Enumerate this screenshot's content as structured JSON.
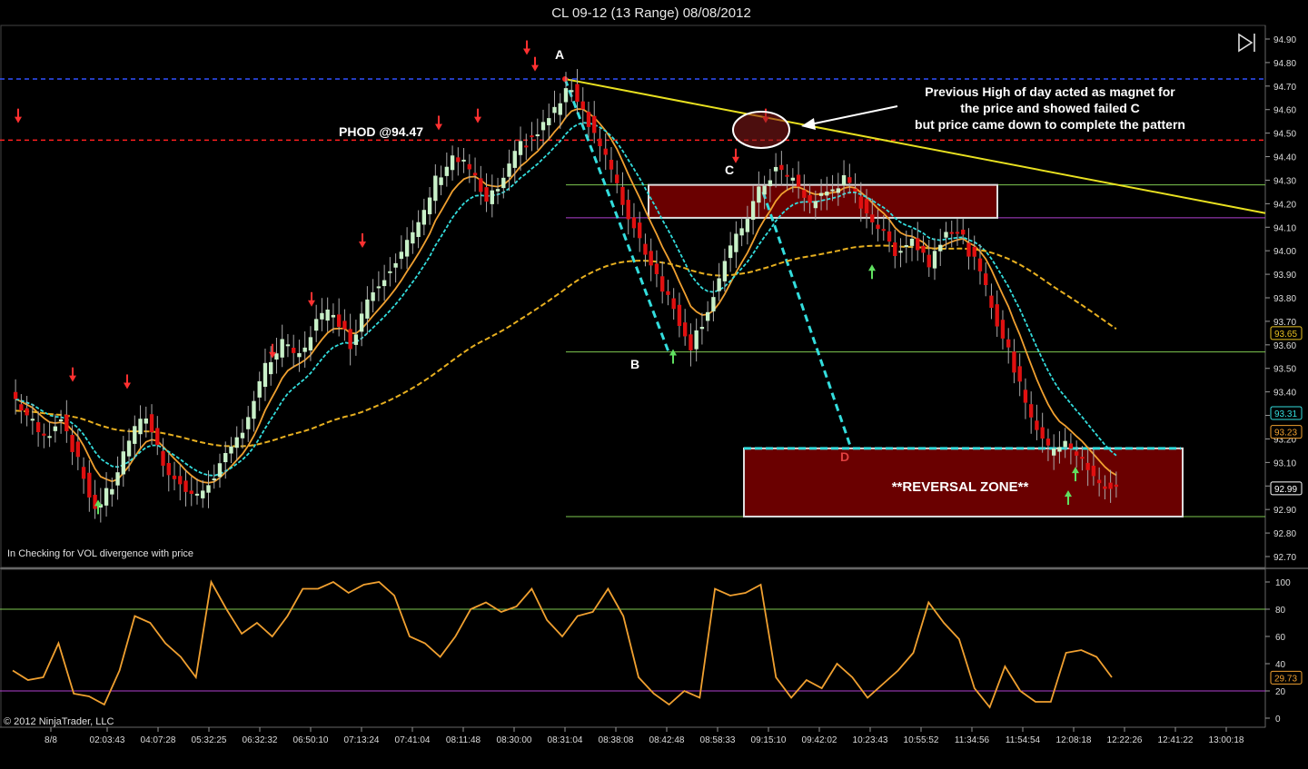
{
  "window": {
    "title": "CL 09-12 (13 Range)  08/08/2012",
    "copyright": "© 2012 NinjaTrader, LLC"
  },
  "colors": {
    "background": "#000000",
    "up_candle": "#c8f0c8",
    "down_candle": "#e01010",
    "ema_fast": "#f0a030",
    "ema_cyan": "#33dddd",
    "sma_slow": "#e8b020",
    "phod_line": "#ff2020",
    "high_line": "#3050ff",
    "trendline": "#e8e020",
    "zone_fill": "#6a0000",
    "oscillator": "#f0a030",
    "osc_level_80": "#7ec850",
    "osc_level_20": "#b040d0"
  },
  "annotations": {
    "phod_label": "PHOD @94.47",
    "point_a": "A",
    "point_b": "B",
    "point_c": "C",
    "point_d": "D",
    "reversal_zone": "**REVERSAL ZONE**",
    "note_line1": "Previous High of day acted as magnet for",
    "note_line2": "the price and showed failed C",
    "note_line3": "but price came down to complete the pattern",
    "indicator_text": "In  Checking for VOL  divergence with price"
  },
  "chart_data": [
    {
      "type": "candlestick",
      "title": "CL 09-12 (13 Range)  08/08/2012",
      "x_tick_labels": [
        "8/8",
        "02:03:43",
        "04:07:28",
        "05:32:25",
        "06:32:32",
        "06:50:10",
        "07:13:24",
        "07:41:04",
        "08:11:48",
        "08:30:00",
        "08:31:04",
        "08:38:08",
        "08:42:48",
        "08:58:33",
        "09:15:10",
        "09:42:02",
        "10:23:43",
        "10:55:52",
        "11:34:56",
        "11:54:54",
        "12:08:18",
        "12:22:26",
        "12:41:22",
        "13:00:18"
      ],
      "y_ticks": [
        92.7,
        92.8,
        92.9,
        93.0,
        93.1,
        93.2,
        93.3,
        93.4,
        93.5,
        93.6,
        93.7,
        93.8,
        93.9,
        94.0,
        94.1,
        94.2,
        94.3,
        94.4,
        94.5,
        94.6,
        94.7,
        94.8,
        94.9
      ],
      "ylim": [
        92.66,
        94.94
      ],
      "price_markers": [
        {
          "label": "93.65",
          "value": 93.65,
          "color": "#e8c020"
        },
        {
          "label": "93.31",
          "value": 93.31,
          "color": "#33dddd"
        },
        {
          "label": "93.23",
          "value": 93.23,
          "color": "#f0a030"
        },
        {
          "label": "92.99",
          "value": 92.99,
          "color": "#ffffff"
        }
      ],
      "levels": {
        "phod": 94.47,
        "day_high": 94.73,
        "zone_top": 93.16,
        "zone_bottom": 92.87
      },
      "key_points": {
        "A": 94.73,
        "B": 93.56,
        "C": 94.36,
        "D": 93.16
      },
      "close_path": [
        93.4,
        93.3,
        93.2,
        93.3,
        93.1,
        92.9,
        93.0,
        93.2,
        93.3,
        93.1,
        93.0,
        92.95,
        93.05,
        93.15,
        93.3,
        93.5,
        93.6,
        93.55,
        93.7,
        93.75,
        93.6,
        93.8,
        93.9,
        94.0,
        94.1,
        94.3,
        94.4,
        94.35,
        94.2,
        94.3,
        94.45,
        94.5,
        94.6,
        94.7,
        94.55,
        94.4,
        94.2,
        94.05,
        93.9,
        93.75,
        93.6,
        93.75,
        93.95,
        94.1,
        94.25,
        94.35,
        94.3,
        94.2,
        94.25,
        94.3,
        94.2,
        94.1,
        94.0,
        94.05,
        93.95,
        94.1,
        94.05,
        93.9,
        93.7,
        93.5,
        93.3,
        93.15,
        93.2,
        93.1,
        93.0
      ],
      "indicator_values": {
        "ema_fast": 93.23,
        "ema_cyan": 93.31,
        "sma_slow": 93.65
      }
    },
    {
      "type": "line",
      "series": [
        {
          "name": "",
          "values": [
            35,
            28,
            30,
            55,
            18,
            16,
            10,
            35,
            75,
            70,
            55,
            45,
            30,
            100,
            80,
            62,
            70,
            60,
            75,
            95,
            95,
            100,
            92,
            98,
            100,
            90,
            60,
            55,
            45,
            60,
            80,
            85,
            78,
            82,
            95,
            72,
            60,
            75,
            78,
            95,
            75,
            30,
            18,
            10,
            20,
            15,
            95,
            90,
            92,
            98,
            30,
            15,
            28,
            22,
            40,
            30,
            15,
            25,
            35,
            48,
            85,
            70,
            58,
            22,
            8,
            38,
            20,
            12,
            12,
            48,
            50,
            45,
            30
          ]
        }
      ],
      "y_ticks": [
        0,
        20,
        40,
        60,
        80,
        100
      ],
      "ylim": [
        -5,
        105
      ],
      "levels": [
        80,
        20
      ],
      "last_value_label": "29.73",
      "last_value": 29.73
    }
  ]
}
